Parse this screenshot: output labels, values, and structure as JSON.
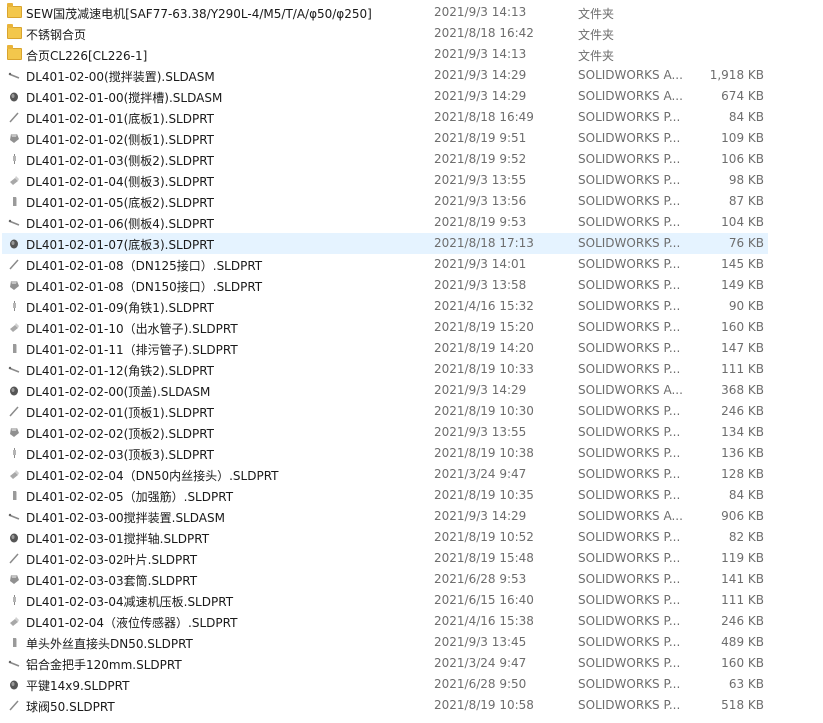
{
  "files": [
    {
      "icon": "folder-icon",
      "name": "SEW国茂减速电机[SAF77-63.38/Y290L-4/M5/T/A/φ50/φ250]",
      "date": "2021/9/3 14:13",
      "type": "文件夹",
      "size": ""
    },
    {
      "icon": "folder-icon",
      "name": "不锈钢合页",
      "date": "2021/8/18 16:42",
      "type": "文件夹",
      "size": ""
    },
    {
      "icon": "folder-icon",
      "name": "合页CL226[CL226-1]",
      "date": "2021/9/3 14:13",
      "type": "文件夹",
      "size": ""
    },
    {
      "icon": "solidworks-assembly-icon",
      "name": "DL401-02-00(搅拌装置).SLDASM",
      "date": "2021/9/3 14:29",
      "type": "SOLIDWORKS A...",
      "size": "1,918 KB"
    },
    {
      "icon": "solidworks-assembly-icon",
      "name": "DL401-02-01-00(搅拌槽).SLDASM",
      "date": "2021/9/3 14:29",
      "type": "SOLIDWORKS A...",
      "size": "674 KB"
    },
    {
      "icon": "solidworks-part-icon",
      "name": "DL401-02-01-01(底板1).SLDPRT",
      "date": "2021/8/18 16:49",
      "type": "SOLIDWORKS P...",
      "size": "84 KB"
    },
    {
      "icon": "solidworks-part-icon",
      "name": "DL401-02-01-02(侧板1).SLDPRT",
      "date": "2021/8/19 9:51",
      "type": "SOLIDWORKS P...",
      "size": "109 KB"
    },
    {
      "icon": "solidworks-part-icon",
      "name": "DL401-02-01-03(侧板2).SLDPRT",
      "date": "2021/8/19 9:52",
      "type": "SOLIDWORKS P...",
      "size": "106 KB"
    },
    {
      "icon": "solidworks-part-icon",
      "name": "DL401-02-01-04(侧板3).SLDPRT",
      "date": "2021/9/3 13:55",
      "type": "SOLIDWORKS P...",
      "size": "98 KB"
    },
    {
      "icon": "solidworks-part-icon",
      "name": "DL401-02-01-05(底板2).SLDPRT",
      "date": "2021/9/3 13:56",
      "type": "SOLIDWORKS P...",
      "size": "87 KB"
    },
    {
      "icon": "solidworks-part-icon",
      "name": "DL401-02-01-06(侧板4).SLDPRT",
      "date": "2021/8/19 9:53",
      "type": "SOLIDWORKS P...",
      "size": "104 KB"
    },
    {
      "icon": "solidworks-part-icon",
      "name": "DL401-02-01-07(底板3).SLDPRT",
      "date": "2021/8/18 17:13",
      "type": "SOLIDWORKS P...",
      "size": "76 KB",
      "selected": true
    },
    {
      "icon": "solidworks-part-icon",
      "name": "DL401-02-01-08（DN125接口）.SLDPRT",
      "date": "2021/9/3 14:01",
      "type": "SOLIDWORKS P...",
      "size": "145 KB"
    },
    {
      "icon": "solidworks-part-icon",
      "name": "DL401-02-01-08（DN150接口）.SLDPRT",
      "date": "2021/9/3 13:58",
      "type": "SOLIDWORKS P...",
      "size": "149 KB"
    },
    {
      "icon": "solidworks-part-icon",
      "name": "DL401-02-01-09(角铁1).SLDPRT",
      "date": "2021/4/16 15:32",
      "type": "SOLIDWORKS P...",
      "size": "90 KB"
    },
    {
      "icon": "solidworks-part-icon",
      "name": "DL401-02-01-10（出水管子).SLDPRT",
      "date": "2021/8/19 15:20",
      "type": "SOLIDWORKS P...",
      "size": "160 KB"
    },
    {
      "icon": "solidworks-part-icon",
      "name": "DL401-02-01-11（排污管子).SLDPRT",
      "date": "2021/8/19 14:20",
      "type": "SOLIDWORKS P...",
      "size": "147 KB"
    },
    {
      "icon": "solidworks-part-icon",
      "name": "DL401-02-01-12(角铁2).SLDPRT",
      "date": "2021/8/19 10:33",
      "type": "SOLIDWORKS P...",
      "size": "111 KB"
    },
    {
      "icon": "solidworks-assembly-icon",
      "name": "DL401-02-02-00(顶盖).SLDASM",
      "date": "2021/9/3 14:29",
      "type": "SOLIDWORKS A...",
      "size": "368 KB"
    },
    {
      "icon": "solidworks-part-icon",
      "name": "DL401-02-02-01(顶板1).SLDPRT",
      "date": "2021/8/19 10:30",
      "type": "SOLIDWORKS P...",
      "size": "246 KB"
    },
    {
      "icon": "solidworks-part-icon",
      "name": "DL401-02-02-02(顶板2).SLDPRT",
      "date": "2021/9/3 13:55",
      "type": "SOLIDWORKS P...",
      "size": "134 KB"
    },
    {
      "icon": "solidworks-part-icon",
      "name": "DL401-02-02-03(顶板3).SLDPRT",
      "date": "2021/8/19 10:38",
      "type": "SOLIDWORKS P...",
      "size": "136 KB"
    },
    {
      "icon": "solidworks-part-icon",
      "name": "DL401-02-02-04（DN50内丝接头）.SLDPRT",
      "date": "2021/3/24 9:47",
      "type": "SOLIDWORKS P...",
      "size": "128 KB"
    },
    {
      "icon": "solidworks-part-icon",
      "name": "DL401-02-02-05（加强筋）.SLDPRT",
      "date": "2021/8/19 10:35",
      "type": "SOLIDWORKS P...",
      "size": "84 KB"
    },
    {
      "icon": "solidworks-assembly-icon",
      "name": "DL401-02-03-00搅拌装置.SLDASM",
      "date": "2021/9/3 14:29",
      "type": "SOLIDWORKS A...",
      "size": "906 KB"
    },
    {
      "icon": "solidworks-part-icon",
      "name": "DL401-02-03-01搅拌轴.SLDPRT",
      "date": "2021/8/19 10:52",
      "type": "SOLIDWORKS P...",
      "size": "82 KB"
    },
    {
      "icon": "solidworks-part-icon",
      "name": "DL401-02-03-02叶片.SLDPRT",
      "date": "2021/8/19 15:48",
      "type": "SOLIDWORKS P...",
      "size": "119 KB"
    },
    {
      "icon": "solidworks-part-icon",
      "name": "DL401-02-03-03套筒.SLDPRT",
      "date": "2021/6/28 9:53",
      "type": "SOLIDWORKS P...",
      "size": "141 KB"
    },
    {
      "icon": "solidworks-part-icon",
      "name": "DL401-02-03-04减速机压板.SLDPRT",
      "date": "2021/6/15 16:40",
      "type": "SOLIDWORKS P...",
      "size": "111 KB"
    },
    {
      "icon": "solidworks-part-icon",
      "name": "DL401-02-04（液位传感器）.SLDPRT",
      "date": "2021/4/16 15:38",
      "type": "SOLIDWORKS P...",
      "size": "246 KB"
    },
    {
      "icon": "solidworks-part-icon",
      "name": "单头外丝直接头DN50.SLDPRT",
      "date": "2021/9/3 13:45",
      "type": "SOLIDWORKS P...",
      "size": "489 KB"
    },
    {
      "icon": "solidworks-part-icon",
      "name": "铝合金把手120mm.SLDPRT",
      "date": "2021/3/24 9:47",
      "type": "SOLIDWORKS P...",
      "size": "160 KB"
    },
    {
      "icon": "solidworks-part-icon",
      "name": "平键14x9.SLDPRT",
      "date": "2021/6/28 9:50",
      "type": "SOLIDWORKS P...",
      "size": "63 KB"
    },
    {
      "icon": "solidworks-part-icon",
      "name": "球阀50.SLDPRT",
      "date": "2021/8/19 10:58",
      "type": "SOLIDWORKS P...",
      "size": "518 KB"
    }
  ],
  "colors": {
    "selected_row": "#e5f3ff",
    "folder": "#f3c74c",
    "secondary_text": "#6d6d6d",
    "primary_text": "#1a1a1a"
  }
}
